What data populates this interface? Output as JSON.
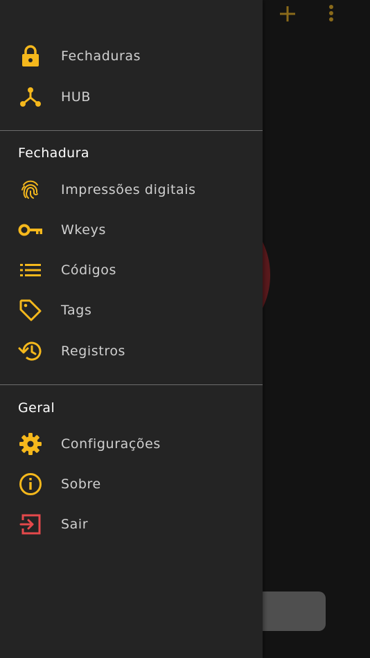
{
  "colors": {
    "accent": "#F5B81C",
    "danger": "#E5494B",
    "drawer_bg": "#242424",
    "text": "#D0D0D0",
    "section_text": "#FFFFFF"
  },
  "app_bar": {
    "add_icon": "plus-icon",
    "more_icon": "more-vertical-icon"
  },
  "drawer": {
    "top_items": [
      {
        "label": "Fechaduras",
        "icon": "lock-icon"
      },
      {
        "label": "HUB",
        "icon": "hub-icon"
      }
    ],
    "sections": [
      {
        "title": "Fechadura",
        "items": [
          {
            "label": "Impressões digitais",
            "icon": "fingerprint-icon"
          },
          {
            "label": "Wkeys",
            "icon": "key-icon"
          },
          {
            "label": "Códigos",
            "icon": "list-icon"
          },
          {
            "label": "Tags",
            "icon": "tag-icon"
          },
          {
            "label": "Registros",
            "icon": "history-icon"
          }
        ]
      },
      {
        "title": "Geral",
        "items": [
          {
            "label": "Configurações",
            "icon": "gear-icon"
          },
          {
            "label": "Sobre",
            "icon": "info-icon"
          },
          {
            "label": "Sair",
            "icon": "logout-icon"
          }
        ]
      }
    ]
  }
}
